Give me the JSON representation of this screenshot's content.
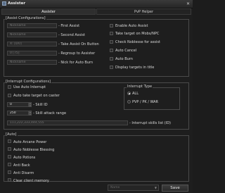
{
  "window": {
    "title": "Assister",
    "icon": "app-icon",
    "close": "close-icon"
  },
  "tabs": [
    {
      "label": "Assister",
      "active": true
    },
    {
      "label": "PvP Helper",
      "active": false
    }
  ],
  "assist_config": {
    "title": "[Assist Configurations]",
    "fields": [
      {
        "placeholder": "Nickname",
        "label": "- First Assist"
      },
      {
        "placeholder": "Nickname",
        "label": "- Second Assist"
      },
      {
        "placeholder": "X: [0/0]",
        "label": "- Take Assist On Button"
      },
      {
        "placeholder": "0 [75]",
        "label": "- Regroup to Assister"
      },
      {
        "placeholder": "Nickname",
        "label": "- Nick for Auto Burn"
      }
    ],
    "checks": [
      {
        "label": "Enable Auto Assist",
        "checked": false
      },
      {
        "label": "Take target on Mobs/NPC",
        "checked": false
      },
      {
        "label": "Check Noblesse for assist",
        "checked": false
      },
      {
        "label": "Auto Cancel",
        "checked": false
      },
      {
        "label": "Auto Burn",
        "checked": false
      },
      {
        "label": "Display targets in title",
        "checked": false
      }
    ]
  },
  "interrupt_config": {
    "title": "[Interrupt Configurations]",
    "checks": [
      {
        "label": "Use Auto Interrupt",
        "checked": false
      },
      {
        "label": "Auto take target on caster",
        "checked": false
      }
    ],
    "skill_id": {
      "value": "0",
      "label": "- Skill ID"
    },
    "skill_range": {
      "value": "250",
      "label": "- Skill attack range"
    },
    "skills_list": {
      "placeholder": "111,222,333,444,555",
      "label": "- Interrupt skills list (ID)"
    },
    "interrupt_type": {
      "title": "Interrupt Type",
      "options": [
        {
          "label": "ALL",
          "selected": true
        },
        {
          "label": "PVP / PK / WAR",
          "selected": false
        }
      ]
    }
  },
  "auto": {
    "title": "[Auto]",
    "checks": [
      {
        "label": "Auto Arcane Power",
        "checked": false
      },
      {
        "label": "Auto Noblesse Blessing",
        "checked": false
      },
      {
        "label": "Auto Potions",
        "checked": false
      },
      {
        "label": "Anti Back",
        "checked": false
      },
      {
        "label": "Anti Disarm",
        "checked": false
      },
      {
        "label": "Clear client memory",
        "checked": false
      }
    ]
  },
  "footer": {
    "profile_placeholder": "Name",
    "save_label": "Save"
  }
}
